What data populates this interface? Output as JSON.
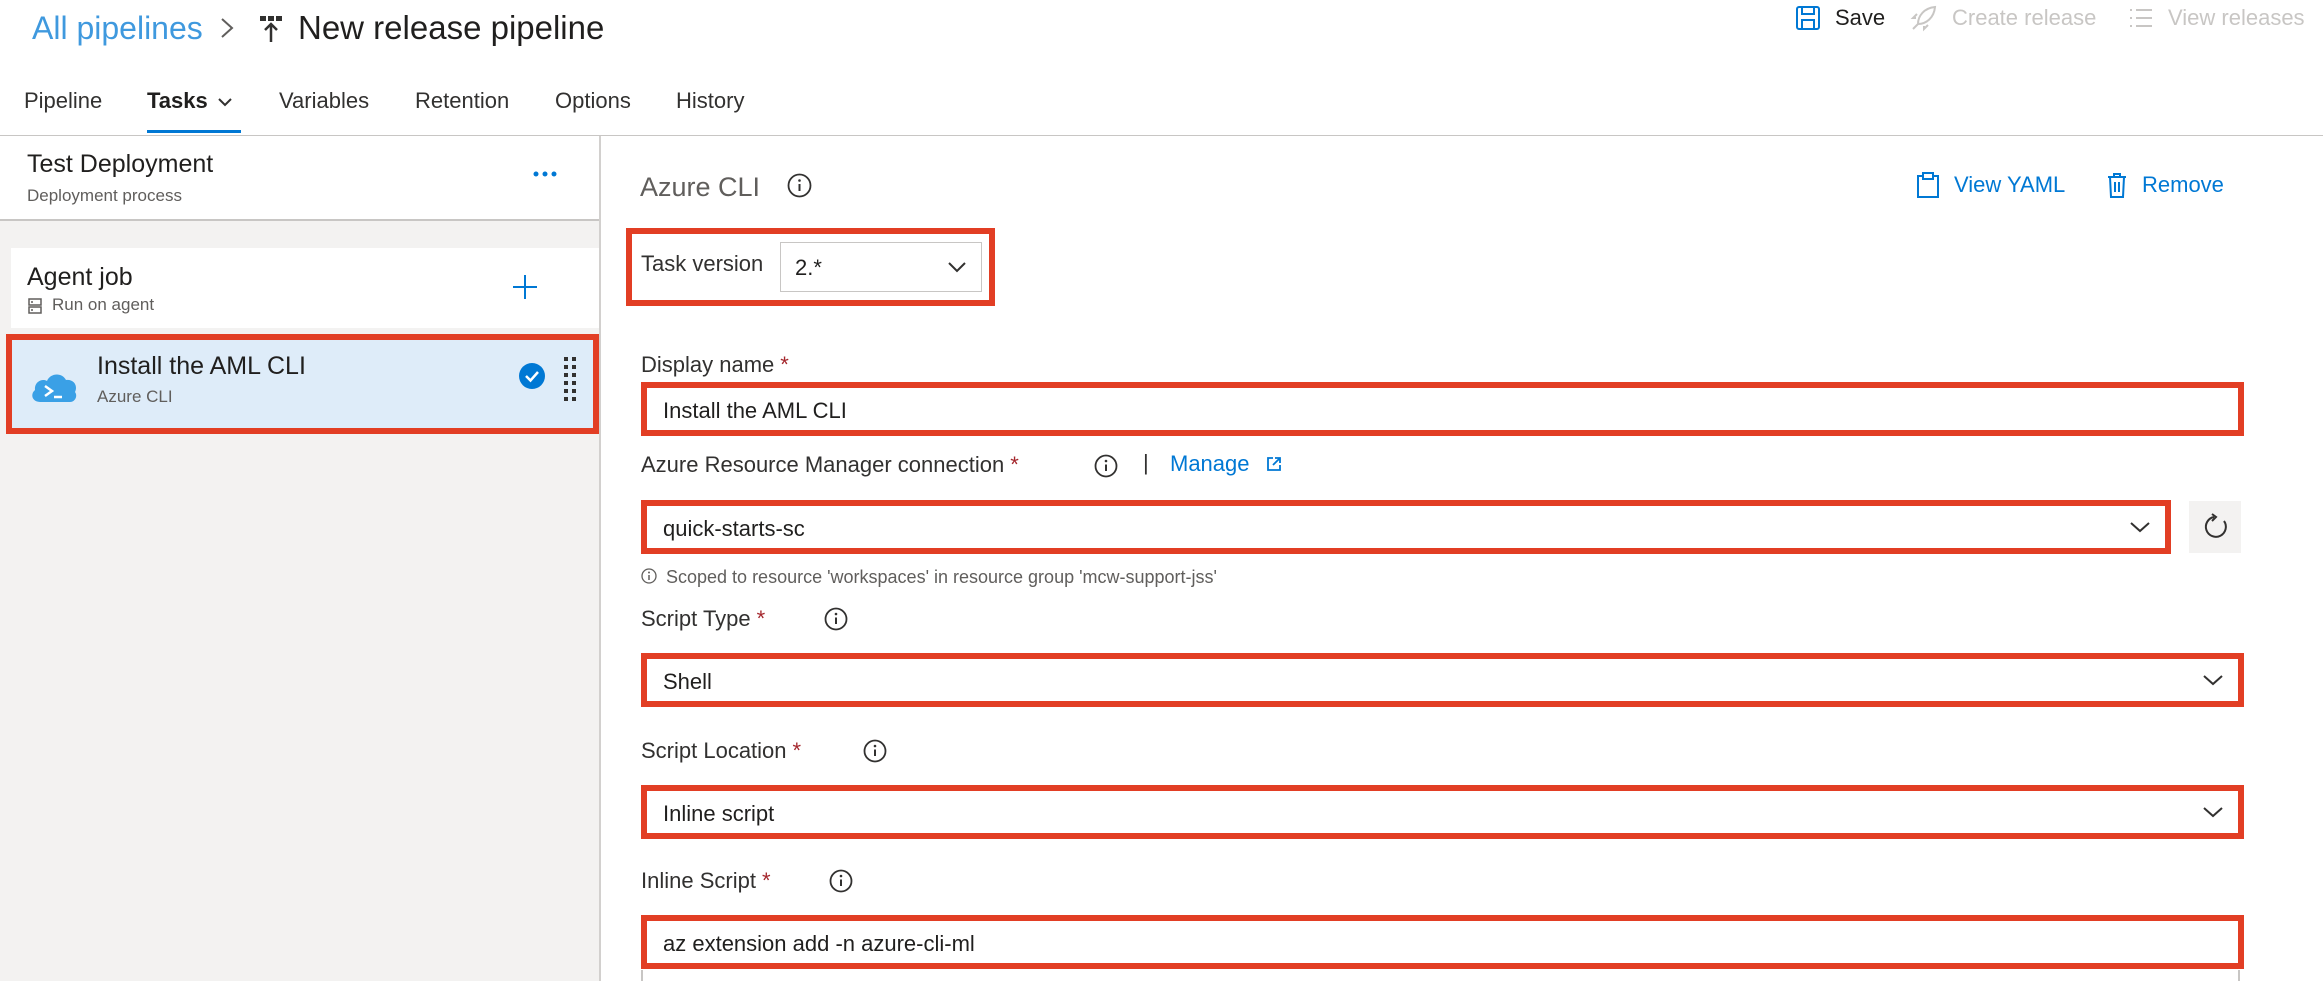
{
  "header": {
    "breadcrumb": "All pipelines",
    "title": "New release pipeline",
    "actions": {
      "save": "Save",
      "create_release": "Create release",
      "view_releases": "View releases"
    }
  },
  "tabs": [
    {
      "label": "Pipeline"
    },
    {
      "label": "Tasks"
    },
    {
      "label": "Variables"
    },
    {
      "label": "Retention"
    },
    {
      "label": "Options"
    },
    {
      "label": "History"
    }
  ],
  "stage": {
    "title": "Test Deployment",
    "subtitle": "Deployment process"
  },
  "job": {
    "title": "Agent job",
    "subtitle": "Run on agent"
  },
  "task": {
    "title": "Install the AML CLI",
    "subtitle": "Azure CLI"
  },
  "panel": {
    "title": "Azure CLI",
    "view_yaml": "View YAML",
    "remove": "Remove",
    "task_version_label": "Task version",
    "task_version_value": "2.*",
    "display_name_label": "Display name",
    "display_name_value": "Install the AML CLI",
    "arm_label": "Azure Resource Manager connection",
    "manage_label": "Manage",
    "arm_value": "quick-starts-sc",
    "scope_note": "Scoped to resource 'workspaces' in resource group 'mcw-support-jss'",
    "script_type_label": "Script Type",
    "script_type_value": "Shell",
    "script_location_label": "Script Location",
    "script_location_value": "Inline script",
    "inline_script_label": "Inline Script",
    "inline_script_value": "az extension add -n azure-cli-ml",
    "required_mark": "*",
    "separator": "|"
  },
  "colors": {
    "accent": "#0078d4",
    "highlight": "#e23e24",
    "selected_bg": "#deecf9"
  }
}
